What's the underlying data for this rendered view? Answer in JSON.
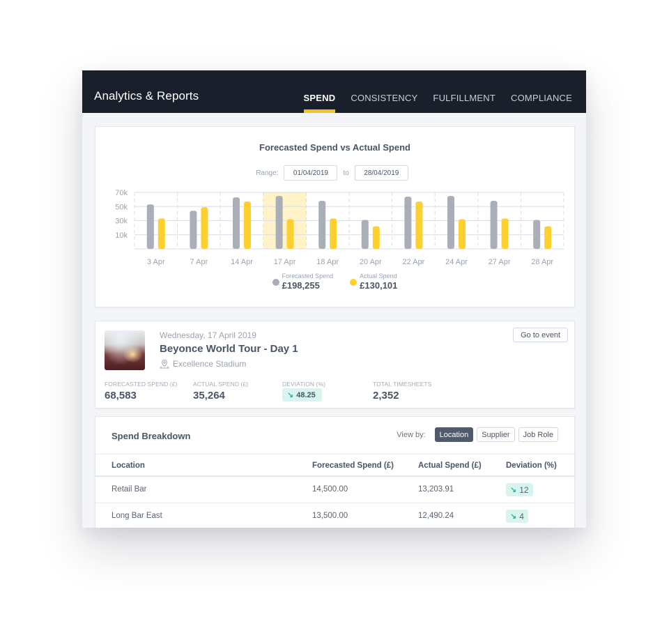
{
  "header": {
    "title": "Analytics & Reports",
    "tabs": [
      {
        "label": "SPEND",
        "active": true
      },
      {
        "label": "CONSISTENCY",
        "active": false
      },
      {
        "label": "FULFILLMENT",
        "active": false
      },
      {
        "label": "COMPLIANCE",
        "active": false
      }
    ]
  },
  "colors": {
    "header_bg": "#1a1f2c",
    "accent": "#f5c22a",
    "forecast": "#a9aeb7",
    "actual": "#fdd02f",
    "highlight": "#fff3c7",
    "deviation_badge": "#d6f5ef",
    "deviation_arrow": "#2bb5a6"
  },
  "chart_card": {
    "range_label": "Range:",
    "range_from": "01/04/2019",
    "range_to_label": "to",
    "range_to": "28/04/2019",
    "legend": [
      {
        "label": "Forecasted Spend",
        "total": "£198,255"
      },
      {
        "label": "Actual Spend",
        "total": "£130,101"
      }
    ]
  },
  "chart_data": {
    "type": "bar",
    "title": "Forecasted Spend vs Actual Spend",
    "xlabel": "",
    "ylabel": "",
    "categories": [
      "3 Apr",
      "7 Apr",
      "14 Apr",
      "17 Apr",
      "18 Apr",
      "20 Apr",
      "22 Apr",
      "24 Apr",
      "27 Apr",
      "28 Apr"
    ],
    "series": [
      {
        "name": "Forecasted Spend",
        "values": [
          53,
          44,
          63,
          65,
          58,
          31,
          64,
          65,
          58,
          31
        ]
      },
      {
        "name": "Actual Spend",
        "values": [
          33,
          49,
          57,
          32,
          33,
          22,
          57,
          32,
          33,
          22
        ]
      }
    ],
    "units": "k £",
    "yticks": [
      10,
      30,
      50,
      70
    ],
    "ytick_labels": [
      "10k",
      "30k",
      "50k",
      "70k"
    ],
    "ylim": [
      -10,
      70
    ],
    "highlighted_category": "17 Apr",
    "grid": true,
    "legend_position": "bottom-center"
  },
  "event": {
    "date": "Wednesday, 17 April 2019",
    "name": "Beyonce World Tour - Day 1",
    "venue": "Excellence Stadium",
    "goto_label": "Go to event",
    "stats": [
      {
        "label": "FORECASTED SPEND (£)",
        "value": "68,583"
      },
      {
        "label": "ACTUAL SPEND (£)",
        "value": "35,264"
      },
      {
        "label": "DEVIATION (%)",
        "value": "48.25",
        "direction": "down"
      },
      {
        "label": "TOTAL TIMESHEETS",
        "value": "2,352"
      }
    ]
  },
  "breakdown": {
    "title": "Spend Breakdown",
    "view_by_label": "View by:",
    "view_options": [
      {
        "label": "Location",
        "active": true
      },
      {
        "label": "Supplier",
        "active": false
      },
      {
        "label": "Job Role",
        "active": false
      }
    ],
    "columns": [
      "Location",
      "Forecasted Spend (£)",
      "Actual Spend (£)",
      "Deviation (%)"
    ],
    "rows": [
      {
        "location": "Retail Bar",
        "forecasted": "14,500.00",
        "actual": "13,203.91",
        "deviation": "12",
        "direction": "down"
      },
      {
        "location": "Long Bar East",
        "forecasted": "13,500.00",
        "actual": "12,490.24",
        "deviation": "4",
        "direction": "down"
      }
    ]
  }
}
